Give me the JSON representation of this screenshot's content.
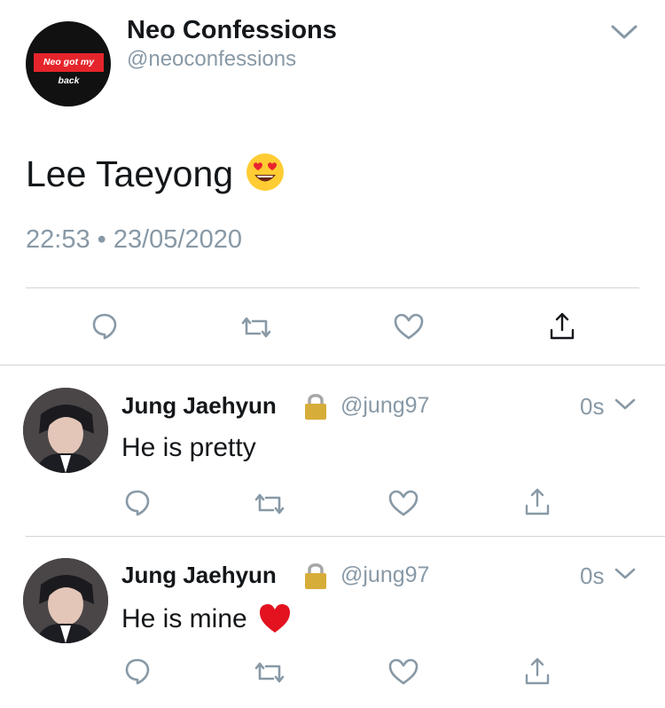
{
  "main_tweet": {
    "display_name": "Neo Confessions",
    "handle": "@neoconfessions",
    "avatar_text": "Neo got my back",
    "text": "Lee Taeyong",
    "time": "22:53",
    "separator": "•",
    "date": "23/05/2020"
  },
  "replies": [
    {
      "display_name": "Jung Jaehyun",
      "handle": "@jung97",
      "time": "0s",
      "text": "He is pretty"
    },
    {
      "display_name": "Jung Jaehyun",
      "handle": "@jung97",
      "time": "0s",
      "text": "He is mine"
    }
  ],
  "icons": [
    "chevron-down-icon",
    "smiling-face-heart-eyes-icon",
    "reply-icon",
    "retweet-icon",
    "like-icon",
    "share-icon",
    "lock-icon",
    "red-heart-icon"
  ],
  "colors": {
    "gray": "#8899a6",
    "text": "#14171a",
    "divider": "#cfd5da",
    "logo_red": "#e5252b"
  }
}
